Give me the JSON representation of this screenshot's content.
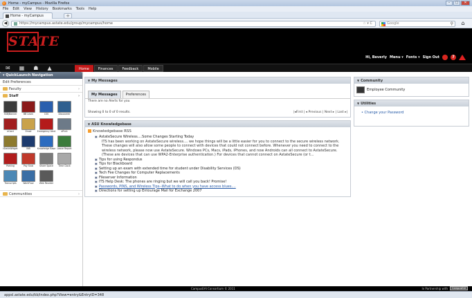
{
  "window": {
    "title": "Home - myCampus - Mozilla Firefox",
    "min": "–",
    "max": "▢",
    "close": "✕"
  },
  "menu": [
    "File",
    "Edit",
    "View",
    "History",
    "Bookmarks",
    "Tools",
    "Help"
  ],
  "tabs": {
    "active_label": "Home - myCampus",
    "new_tab": "+"
  },
  "nav": {
    "back": "◀",
    "url": "https://mycampus.astate.edu/group/mycampus/home",
    "url_icons": "☆ ▾ C",
    "search_placeholder": "Google",
    "search_icon": "⚲",
    "home": "⌂"
  },
  "header": {
    "logo_text": "STATE",
    "greeting": "Hi, Beverly",
    "menu_label": "Menu ▾",
    "fonts_label": "Fonts ▾",
    "signout_label": "Sign Out",
    "help_icon": "?"
  },
  "navstrip": {
    "icons": [
      "✉",
      "▦",
      "☗",
      "▲"
    ],
    "tabs": [
      {
        "label": "Home",
        "active": true
      },
      {
        "label": "Finances",
        "active": false
      },
      {
        "label": "Feedback",
        "active": false
      },
      {
        "label": "Mobile",
        "active": false
      }
    ]
  },
  "left": {
    "header": "▾ QuickLaunch Navigation",
    "edit": "Edit Preferences",
    "faculty": "Faculty",
    "staff": "Staff",
    "communities": "Communities",
    "arrow": "›",
    "apps": [
      [
        {
          "label": "SSB/Banner",
          "color": "#3b3b3b"
        },
        {
          "label": "BB Learn",
          "color": "#8b1a1a"
        },
        {
          "label": "CSS",
          "color": "#2a5fae"
        },
        {
          "label": "Discoverer",
          "color": "#2f5f8f"
        }
      ],
      [
        {
          "label": "eCard",
          "color": "#a11e1e"
        },
        {
          "label": "Email",
          "color": "#c9a24a"
        },
        {
          "label": "Emergency Alert",
          "color": "#b41a1a"
        },
        {
          "label": "ePrint",
          "color": "#6d7a88"
        }
      ],
      [
        {
          "label": "iStaticWidget",
          "color": "#8d7a2e"
        },
        {
          "label": "INB",
          "color": "#1d3b6e"
        },
        {
          "label": "Knowledge Base",
          "color": "#2c6cbf"
        },
        {
          "label": "Leave Report",
          "color": "#3b7c3b"
        }
      ],
      [
        {
          "label": "Parking",
          "color": "#b11d1d"
        },
        {
          "label": "Pay Stub",
          "color": "#c0392b"
        },
        {
          "label": "Shore Space",
          "color": "#7a7a7a"
        },
        {
          "label": "Time Clock",
          "color": "#a8a8a8"
        }
      ],
      [
        {
          "label": "Transcripts",
          "color": "#4c88b5"
        },
        {
          "label": "WorkFlow",
          "color": "#3a6ea5"
        },
        {
          "label": "Web Reorder",
          "color": "#5a5a5a"
        }
      ]
    ]
  },
  "messages": {
    "title": "My Messages",
    "tab1": "My Messages",
    "tab2": "Preferences",
    "no_alerts": "There are no Alerts for you",
    "showing": "Showing 0 to 0 of 0 results.",
    "pager": "|◂First | ◂ Previous | Next ▸ | Last ▸|"
  },
  "kb": {
    "title": "ASU Knowledgebase",
    "rss_title": "Knowledgebase RSS",
    "items": [
      {
        "title": "AstateSecure Wireless....Some Changes Starting Today",
        "desc": "ITS has been working on AstateSecure wireless.... we hope things will be a little easier for you to connect to the secure wireless network. These changes will also allow some people to connect with devices that could not connect before. Whenever you need to connect to the wireless network, please now use AstateSecure. Windows PCs, Macs, iPads, iPhones, and now Androids can all connect to AstateSecure. (These are devices that can use WPA2-Enterprise authentication.) For devices that cannot connect on AstateSecure (or t...",
        "link": false
      },
      {
        "title": "Tips for using Respondus",
        "desc": "",
        "link": false
      },
      {
        "title": "Tips for Blackboard",
        "desc": "",
        "link": false
      },
      {
        "title": "Setting up an exam with extended time for student under Disability Services (DS)",
        "desc": "",
        "link": false
      },
      {
        "title": "Tech Fee Changes for Computer Replacements",
        "desc": "",
        "link": false
      },
      {
        "title": "Fileserver Information",
        "desc": "",
        "link": false
      },
      {
        "title": "ITS Help Desk: The phones are ringing but we will call you back! Promise!",
        "desc": "",
        "link": false
      },
      {
        "title": "Passwords, PINS, and Wireless Tips--What to do when you have access blues....",
        "desc": "",
        "link": true
      },
      {
        "title": "Directions for setting up Entourage Mail for Exchange 2007",
        "desc": "",
        "link": false
      }
    ]
  },
  "community": {
    "title": "Community",
    "item": "Employee Community"
  },
  "utilities": {
    "title": "Utilities",
    "item": "Change your Password"
  },
  "footer": {
    "copyright": "CampusEAI Consortium © 2011",
    "partner": "In Partnership with",
    "partner_logo": "CampusEAI"
  },
  "status": {
    "text": "appsl.astate.edu/kb/index.php?View=entry&EntryID=348"
  }
}
